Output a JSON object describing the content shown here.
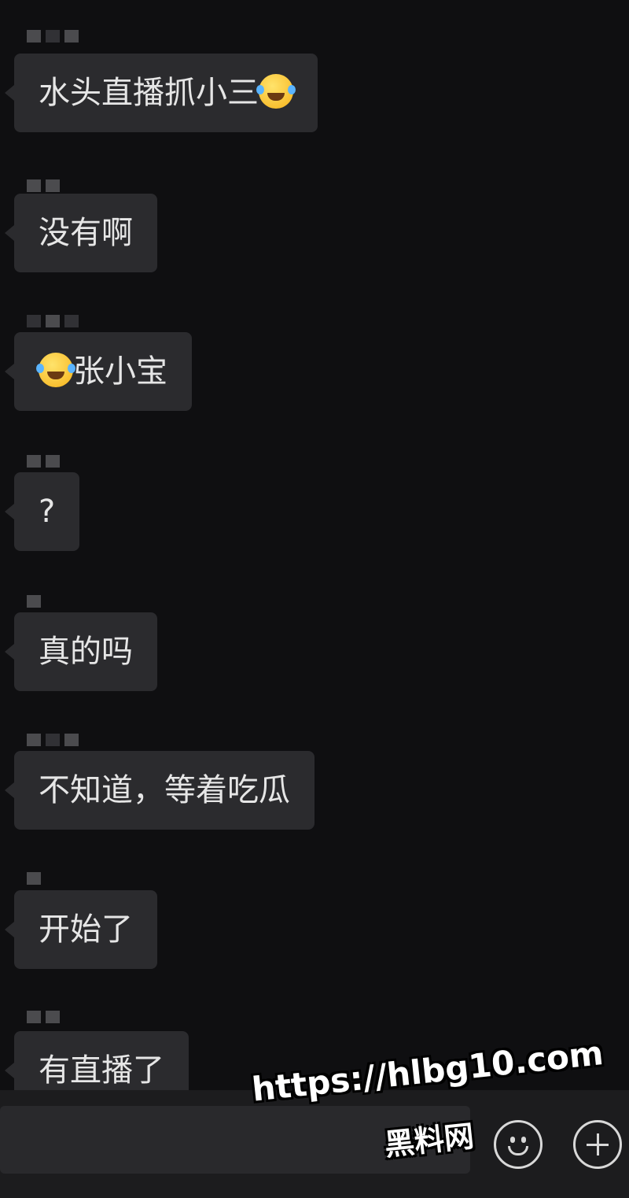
{
  "messages": [
    {
      "text": "水头直播抓小三",
      "emoji": "laughing-tears-emoji"
    },
    {
      "text": "没有啊"
    },
    {
      "text": "张小宝",
      "emoji": "face-palm-tears-emoji"
    },
    {
      "text": "?"
    },
    {
      "text": "真的吗"
    },
    {
      "text": "不知道，等着吃瓜"
    },
    {
      "text": "开始了"
    },
    {
      "text": "有直播了"
    }
  ],
  "input_bar": {
    "icons": [
      "emoji-face-icon",
      "plus-circle-icon"
    ]
  },
  "watermark": {
    "url": "https://hlbg10.com",
    "name": "黑料网"
  },
  "colors": {
    "background": "#0f0f11",
    "bubble": "#2b2b2e",
    "text": "#e6e6e6",
    "emoji_yellow": "#f6b21a"
  }
}
